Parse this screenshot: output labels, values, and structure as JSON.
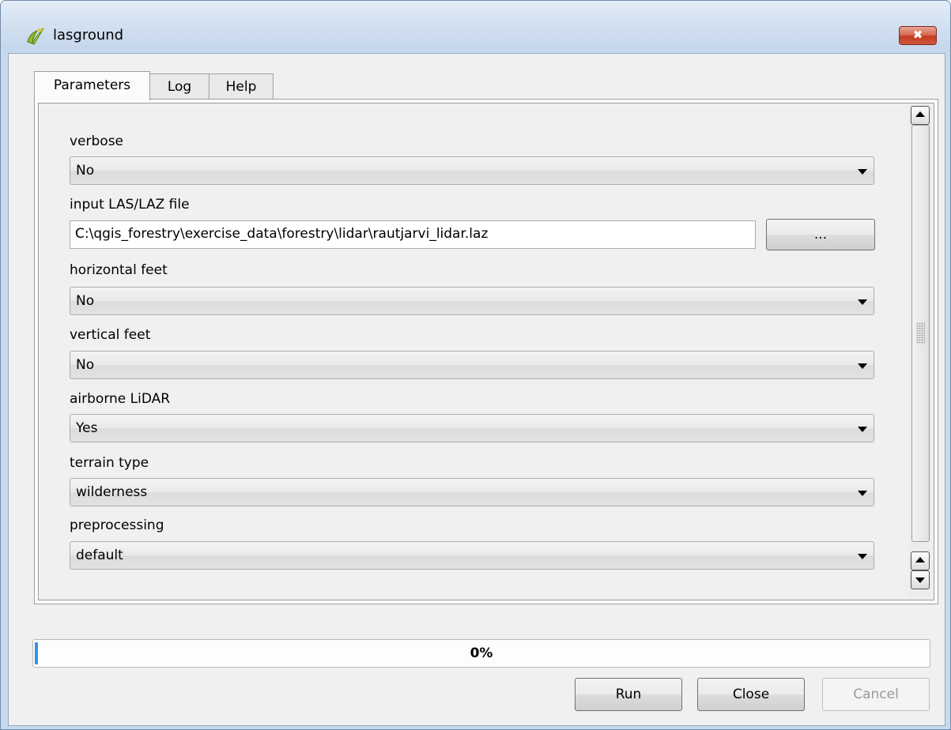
{
  "window": {
    "title": "lasground",
    "close_glyph": "✖"
  },
  "tabs": [
    {
      "label": "Parameters",
      "active": true
    },
    {
      "label": "Log",
      "active": false
    },
    {
      "label": "Help",
      "active": false
    }
  ],
  "params": {
    "verbose": {
      "label": "verbose",
      "value": "No"
    },
    "input_file": {
      "label": "input LAS/LAZ file",
      "value": "C:\\qgis_forestry\\exercise_data\\forestry\\lidar\\rautjarvi_lidar.laz",
      "browse_label": "..."
    },
    "horizontal_feet": {
      "label": "horizontal feet",
      "value": "No"
    },
    "vertical_feet": {
      "label": "vertical feet",
      "value": "No"
    },
    "airborne_lidar": {
      "label": "airborne LiDAR",
      "value": "Yes"
    },
    "terrain_type": {
      "label": "terrain type",
      "value": "wilderness"
    },
    "preprocessing": {
      "label": "preprocessing",
      "value": "default"
    }
  },
  "progress": {
    "text": "0%",
    "value": 0
  },
  "buttons": {
    "run": "Run",
    "close": "Close",
    "cancel": "Cancel"
  },
  "colors": {
    "accent": "#3a8ee6",
    "close_button": "#c43b20"
  }
}
